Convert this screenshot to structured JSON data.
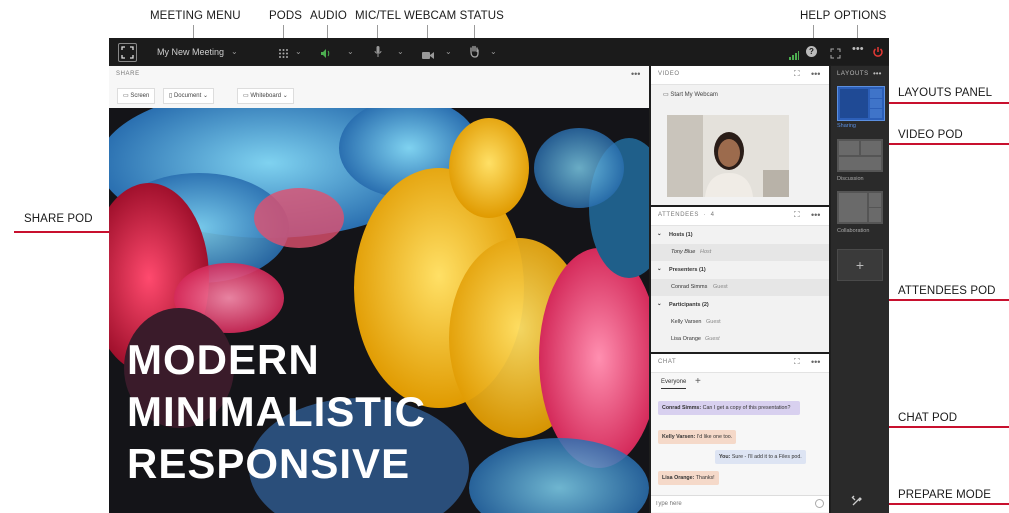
{
  "annotations": {
    "meeting_menu": "MEETING MENU",
    "pods": "PODS",
    "audio": "AUDIO",
    "mic_tel": "MIC/TEL",
    "webcam_status": "WEBCAM STATUS",
    "help": "HELP",
    "options": "OPTIONS",
    "share_pod": "SHARE POD",
    "layouts_panel": "LAYOUTS PANEL",
    "video_pod": "VIDEO POD",
    "attendees_pod": "ATTENDEES POD",
    "chat_pod": "CHAT POD",
    "prepare_mode": "PREPARE MODE"
  },
  "colors": {
    "accent": "#c8102e",
    "app_bg": "#1e1e1e",
    "layout_active": "#2c5fb8"
  },
  "topbar": {
    "meeting_name": "My New Meeting"
  },
  "share": {
    "title": "SHARE",
    "buttons": [
      "Screen",
      "Document",
      "Whiteboard"
    ],
    "slide_lines": [
      "MODERN",
      "MINIMALISTIC",
      "RESPONSIVE"
    ]
  },
  "video": {
    "title": "VIDEO",
    "start_label": "Start My Webcam"
  },
  "attendees": {
    "title": "ATTENDEES",
    "count": "4",
    "hosts_label": "Hosts (1)",
    "hosts": [
      {
        "name": "Tony Blue",
        "role": "Host"
      }
    ],
    "presenters_label": "Presenters (1)",
    "presenters": [
      {
        "name": "Conrad Simms",
        "role": "Guest"
      }
    ],
    "participants_label": "Participants (2)",
    "participants": [
      {
        "name": "Kelly Varsen",
        "role": "Guest"
      },
      {
        "name": "Lisa Orange",
        "role": "Guest"
      }
    ]
  },
  "chat": {
    "title": "CHAT",
    "tab": "Everyone",
    "messages": [
      {
        "sender": "Conrad Simms:",
        "text": "Can I get a copy of this presentation?"
      },
      {
        "sender": "Kelly Varsen:",
        "text": "I'd like one too."
      },
      {
        "sender": "You:",
        "text": "Sure - I'll add it to a Files pod."
      },
      {
        "sender": "Lisa Orange:",
        "text": "Thanks!"
      }
    ],
    "placeholder": "Type here"
  },
  "layouts": {
    "title": "LAYOUTS",
    "items": [
      "Sharing",
      "Discussion",
      "Collaboration"
    ]
  }
}
